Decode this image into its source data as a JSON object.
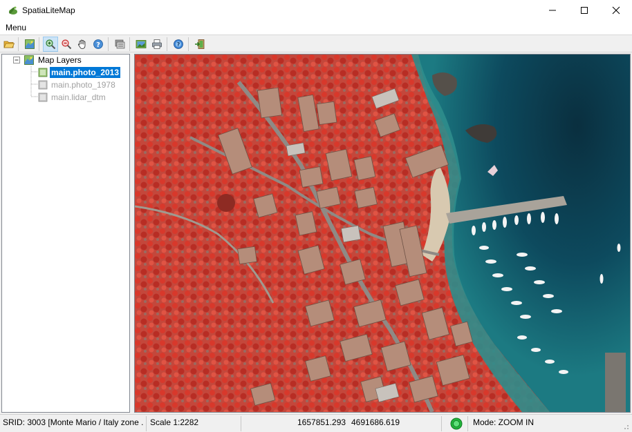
{
  "window": {
    "title": "SpatiaLiteMap"
  },
  "menu": {
    "items": [
      "Menu"
    ]
  },
  "toolbar": {
    "icons": [
      "open-folder-icon",
      "layer-config-icon",
      "zoom-in-icon",
      "zoom-out-icon",
      "pan-hand-icon",
      "identify-icon",
      "layers-stack-icon",
      "export-image-icon",
      "print-icon",
      "info-icon",
      "exit-icon"
    ]
  },
  "tree": {
    "root_label": "Map Layers",
    "layers": [
      {
        "label": "main.photo_2013",
        "state": "selected"
      },
      {
        "label": "main.photo_1978",
        "state": "disabled"
      },
      {
        "label": "main.lidar_dtm",
        "state": "disabled"
      }
    ]
  },
  "status": {
    "srid": "SRID: 3003 [Monte Mario / Italy zone ...",
    "scale": "Scale 1:2282",
    "x": "1657851.293",
    "y": "4691686.619",
    "mode": "Mode: ZOOM IN"
  },
  "colors": {
    "selection": "#0078d7",
    "vegetation": "#c9392e",
    "sea_deep": "#0b3a4e",
    "sea_shallow": "#2c8a8e",
    "status_ok": "#22b43c"
  }
}
